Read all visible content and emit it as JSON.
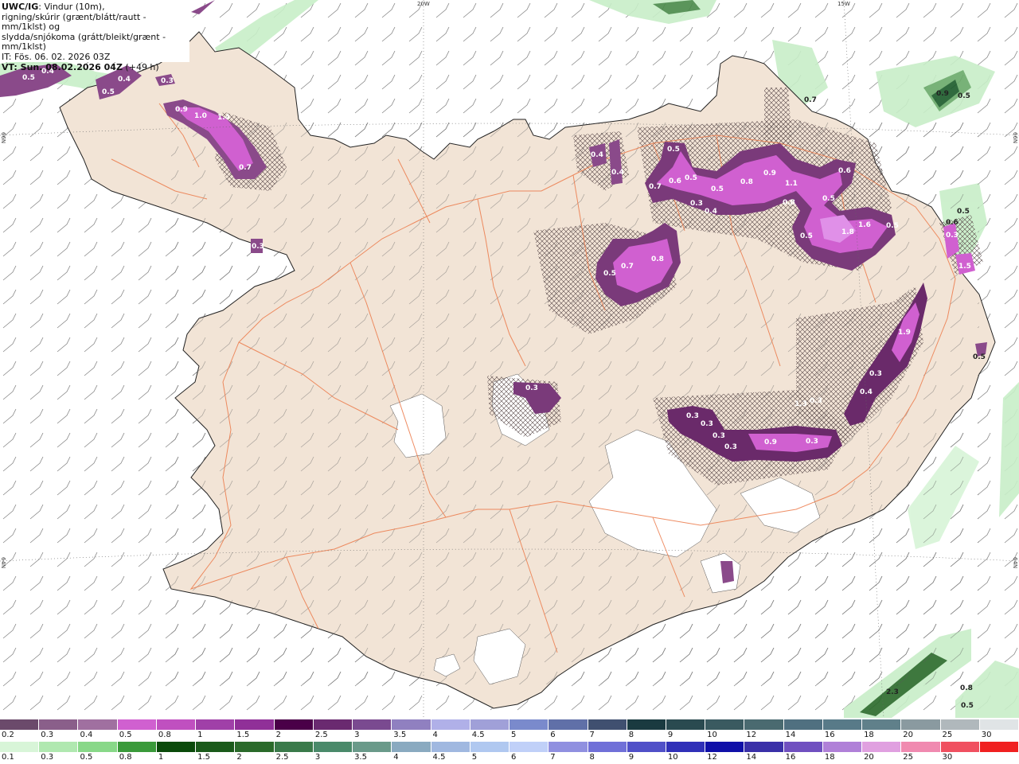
{
  "header": {
    "model": "UWC/IG",
    "line1_rest": ": Vindur (10m),",
    "line2": "rigning/skúrir (grænt/blátt/rautt - mm/1klst) og",
    "line3": "slydda/snjókoma (grátt/bleikt/grænt - mm/1klst)",
    "line4": "IT: Fös. 06. 02. 2026 03Z",
    "line5_bold": "VT: Sun. 08.02.2026 04Z",
    "line5_rest": " (+49 h)"
  },
  "map_labels": {
    "lon_20w": "20W",
    "lon_15w": "15W",
    "lat_66n_left": "66N",
    "lat_66n_right": "66N",
    "lat_64n_left": "64N",
    "lat_64n_right": "64N"
  },
  "precip_values": [
    "0.5",
    "0.4",
    "0.5",
    "0.4",
    "0.3",
    "0.9",
    "1.0",
    "1.4",
    "0.7",
    "0.3",
    "0.4",
    "0.4",
    "0.5",
    "0.7",
    "0.6",
    "0.5",
    "0.3",
    "0.4",
    "0.5",
    "0.8",
    "0.9",
    "1.1",
    "0.8",
    "0.6",
    "0.5",
    "0.5",
    "1.8",
    "1.6",
    "0.5",
    "0.5",
    "0.7",
    "0.8",
    "0.3",
    "0.7",
    "0.9",
    "0.5",
    "0.6",
    "0.5",
    "1.5",
    "0.5",
    "1.9",
    "0.3",
    "0.4",
    "0.3",
    "0.3",
    "0.3",
    "0.3",
    "0.3",
    "0.3",
    "0.9",
    "1.3",
    "0.3",
    "2.3",
    "0.8",
    "0.5"
  ],
  "snow_legend": {
    "colors": [
      "#6b4a6b",
      "#8a5f8a",
      "#a070a0",
      "#d060d0",
      "#c050c0",
      "#a040a8",
      "#903098",
      "#4a0048",
      "#6a2a70",
      "#7a4a90",
      "#9080c0",
      "#b0b0e8",
      "#a0a0d8",
      "#7a8acc",
      "#6070a8",
      "#405070",
      "#1a3a40",
      "#2a4a50",
      "#3a5a60",
      "#4a6a70",
      "#507080",
      "#587a88",
      "#60808a",
      "#8a9aa0",
      "#b0b8bc",
      "#e0e4e6"
    ],
    "ticks": [
      "0.2",
      "0.3",
      "0.4",
      "0.5",
      "0.8",
      "1",
      "1.5",
      "2",
      "2.5",
      "3",
      "3.5",
      "4",
      "4.5",
      "5",
      "6",
      "7",
      "8",
      "9",
      "10",
      "12",
      "14",
      "16",
      "18",
      "20",
      "25",
      "30"
    ]
  },
  "rain_legend": {
    "colors": [
      "#d8f5d8",
      "#b0e8b0",
      "#88d888",
      "#3a9a3a",
      "#0a4a0a",
      "#1a5a1a",
      "#2a6a2a",
      "#3a7a4a",
      "#4a8a6a",
      "#6a9a8a",
      "#8aaac0",
      "#a0b8e0",
      "#b0c8f0",
      "#c0d0f8",
      "#9090e0",
      "#7070d8",
      "#5050c8",
      "#3030b8",
      "#1010a8",
      "#3a30a8",
      "#7050c0",
      "#b080d8",
      "#e0a0e0",
      "#f08ab0",
      "#f05060",
      "#f02020"
    ],
    "ticks": [
      "0.1",
      "0.3",
      "0.5",
      "0.8",
      "1",
      "1.5",
      "2",
      "2.5",
      "3",
      "3.5",
      "4",
      "4.5",
      "5",
      "6",
      "7",
      "8",
      "9",
      "10",
      "12",
      "14",
      "16",
      "18",
      "20",
      "25",
      "30"
    ]
  }
}
